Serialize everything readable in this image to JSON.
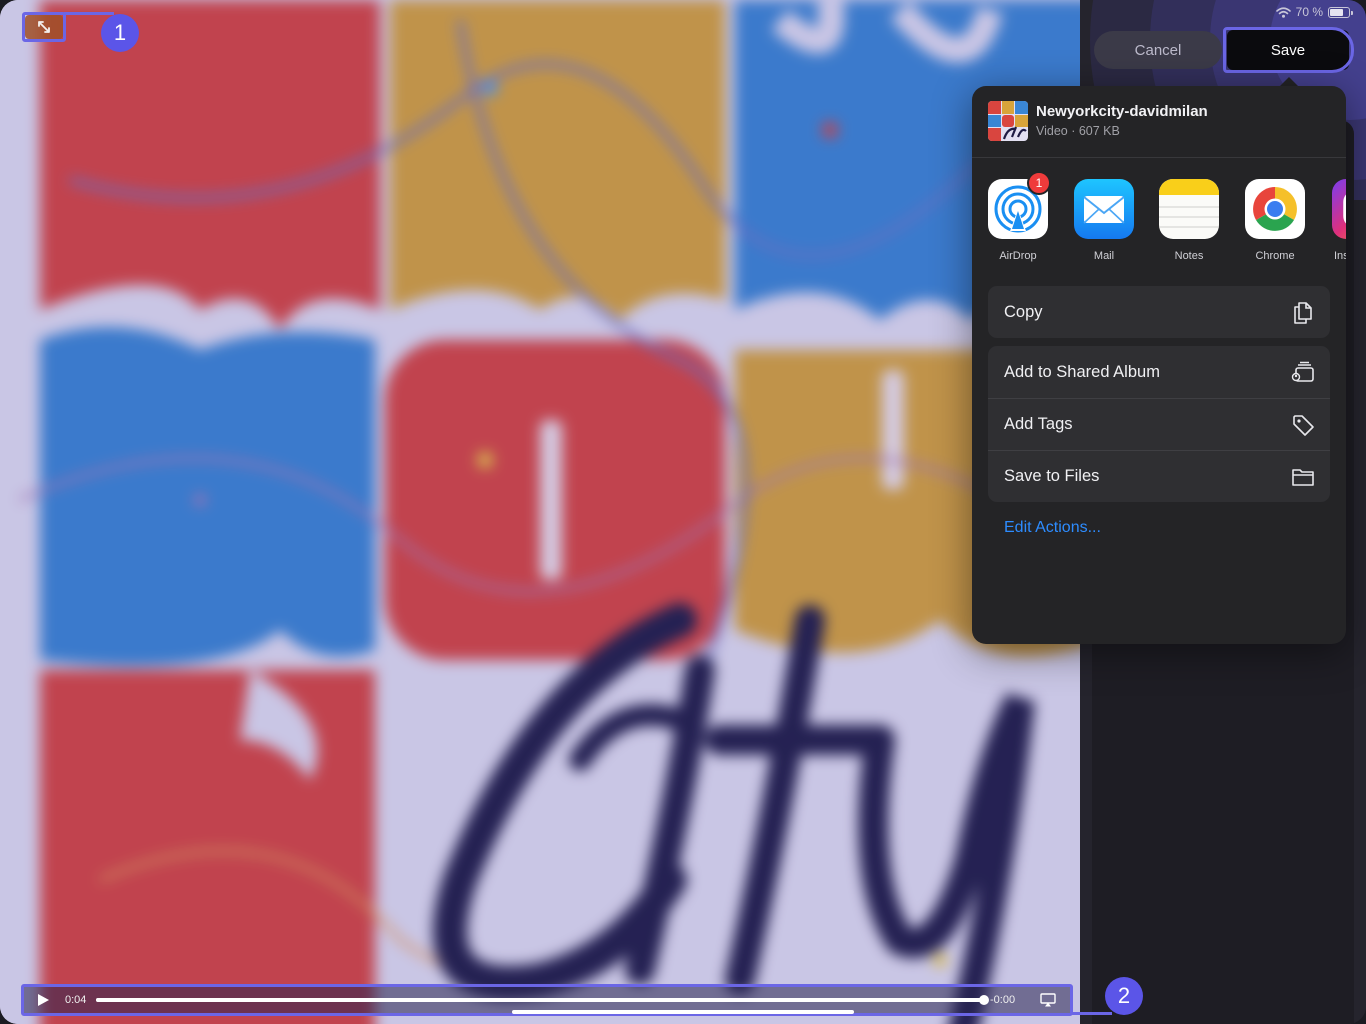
{
  "status_bar": {
    "battery_text": "70 %",
    "battery_level": 0.7,
    "icons": [
      "wifi-icon",
      "battery-icon"
    ]
  },
  "toolbar": {
    "cancel_label": "Cancel",
    "save_label": "Save"
  },
  "markers": {
    "marker_1": "1",
    "marker_2": "2"
  },
  "share_sheet": {
    "file_name": "Newyorkcity-davidmilan",
    "file_meta": "Video · 607 KB",
    "apps": [
      {
        "label": "AirDrop",
        "icon": "airdrop-icon",
        "badge": "1"
      },
      {
        "label": "Mail",
        "icon": "mail-icon"
      },
      {
        "label": "Notes",
        "icon": "notes-icon"
      },
      {
        "label": "Chrome",
        "icon": "chrome-icon"
      },
      {
        "label": "Ins",
        "icon": "instagram-icon"
      }
    ],
    "actions_group_1": [
      {
        "label": "Copy",
        "icon": "copy-icon"
      }
    ],
    "actions_group_2": [
      {
        "label": "Add to Shared Album",
        "icon": "shared-album-icon"
      },
      {
        "label": "Add Tags",
        "icon": "tag-icon"
      },
      {
        "label": "Save to Files",
        "icon": "folder-icon"
      }
    ],
    "edit_actions_label": "Edit Actions..."
  },
  "player": {
    "time_elapsed": "0:04",
    "time_remaining": "-0:00",
    "progress": 1.0,
    "controls": [
      "play-icon",
      "airplay-icon",
      "exit-fullscreen-icon"
    ]
  },
  "colors": {
    "accent_marker": "#5b55e8",
    "link_blue": "#2d8cff",
    "badge_red": "#ef3b3b",
    "sheet_bg": "#242426",
    "art_red": "#d9453f",
    "art_yellow": "#d8a43a",
    "art_blue": "#3a86d4",
    "art_ink": "#1f1c44"
  }
}
